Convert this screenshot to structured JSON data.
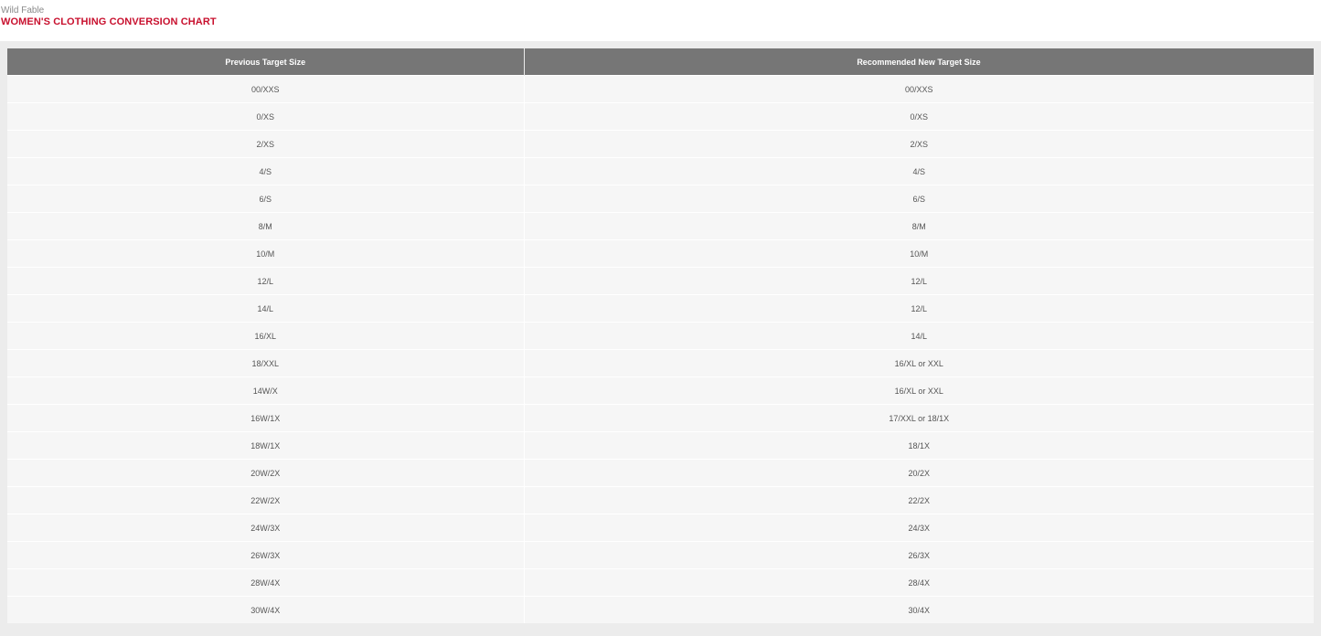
{
  "header": {
    "brand": "Wild Fable",
    "title": "WOMEN'S CLOTHING CONVERSION CHART"
  },
  "table": {
    "columns": [
      "Previous Target Size",
      "Recommended New Target Size"
    ],
    "rows": [
      [
        "00/XXS",
        "00/XXS"
      ],
      [
        "0/XS",
        "0/XS"
      ],
      [
        "2/XS",
        "2/XS"
      ],
      [
        "4/S",
        "4/S"
      ],
      [
        "6/S",
        "6/S"
      ],
      [
        "8/M",
        "8/M"
      ],
      [
        "10/M",
        "10/M"
      ],
      [
        "12/L",
        "12/L"
      ],
      [
        "14/L",
        "12/L"
      ],
      [
        "16/XL",
        "14/L"
      ],
      [
        "18/XXL",
        "16/XL or XXL"
      ],
      [
        "14W/X",
        "16/XL or XXL"
      ],
      [
        "16W/1X",
        "17/XXL or 18/1X"
      ],
      [
        "18W/1X",
        "18/1X"
      ],
      [
        "20W/2X",
        "20/2X"
      ],
      [
        "22W/2X",
        "22/2X"
      ],
      [
        "24W/3X",
        "24/3X"
      ],
      [
        "26W/3X",
        "26/3X"
      ],
      [
        "28W/4X",
        "28/4X"
      ],
      [
        "30W/4X",
        "30/4X"
      ]
    ]
  },
  "colors": {
    "title": "#c8102e",
    "header_bg": "#767676",
    "row_bg": "#f6f6f6",
    "panel_bg": "#ececec"
  }
}
